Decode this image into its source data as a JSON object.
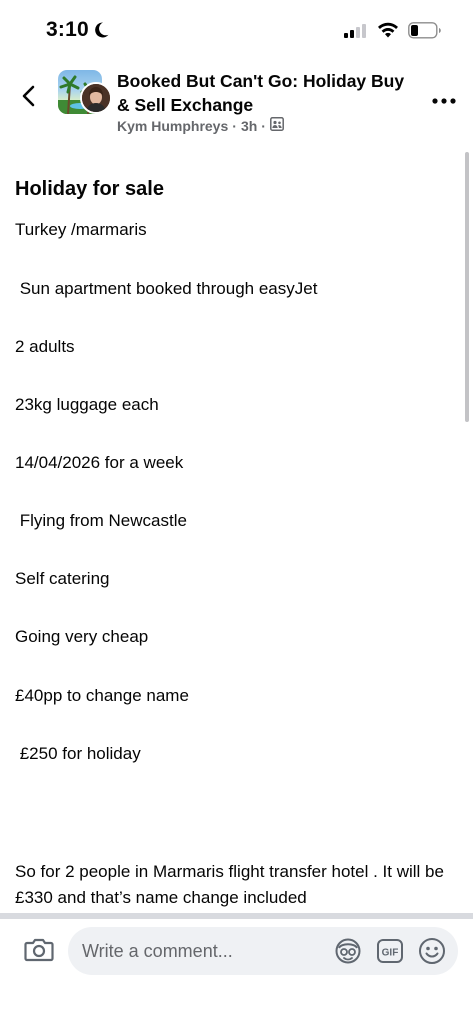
{
  "status": {
    "time": "3:10",
    "icons": [
      "moon-icon",
      "signal-icon",
      "wifi-icon",
      "battery-icon"
    ]
  },
  "header": {
    "group_name": "Booked But Can't Go: Holiday Buy & Sell Exchange",
    "author": "Kym Humphreys",
    "separator": "·",
    "time_ago": "3h",
    "icons": [
      "back-icon",
      "group-members-icon",
      "more-options-icon"
    ]
  },
  "post": {
    "title": "Holiday for sale",
    "lines": [
      "Turkey /marmaris",
      " Sun apartment booked through easyJet",
      "2 adults",
      "23kg luggage each",
      "14/04/2026 for a week",
      " Flying from Newcastle",
      "Self catering",
      "Going very cheap",
      "£40pp to change name",
      " £250 for holiday"
    ],
    "paragraph": "So for 2 people in Marmaris flight transfer hotel . It will be £330 and that’s name change  included"
  },
  "composer": {
    "placeholder": "Write a comment...",
    "icons": [
      "camera-icon",
      "avatar-sticker-icon",
      "gif-icon",
      "emoji-icon"
    ]
  },
  "colors": {
    "text": "#050505",
    "secondary": "#65676b",
    "input_bg": "#eff1f4"
  }
}
